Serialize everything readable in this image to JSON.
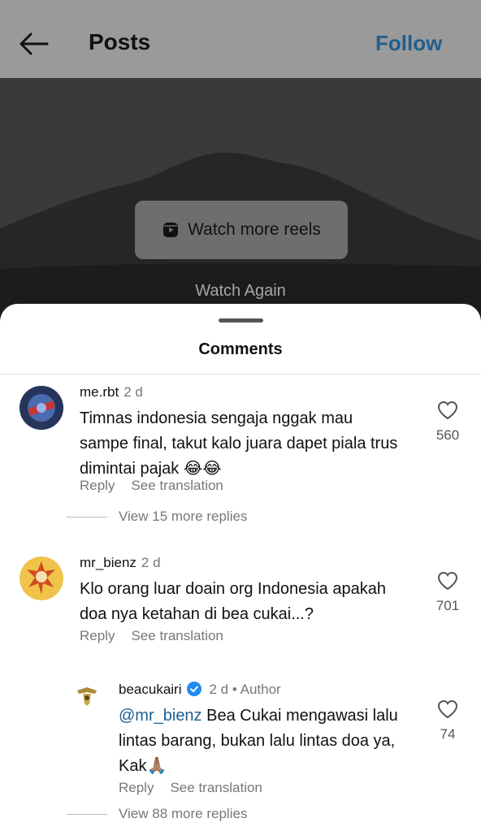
{
  "header": {
    "title": "Posts",
    "follow_label": "Follow"
  },
  "video": {
    "reels_label": "Watch more reels",
    "watch_again": "Watch Again"
  },
  "sheet": {
    "title": "Comments"
  },
  "comments": [
    {
      "username": "me.rbt",
      "time": "2 d",
      "text": "Timnas indonesia sengaja nggak mau sampe final, takut kalo juara dapet piala trus dimintai pajak 😂😂",
      "likes": "560",
      "reply_label": "Reply",
      "translate_label": "See translation",
      "more_replies": "View 15 more replies"
    },
    {
      "username": "mr_bienz",
      "time": "2 d",
      "text": "Klo orang luar doain org Indonesia apakah doa nya ketahan di bea cukai...?",
      "likes": "701",
      "reply_label": "Reply",
      "translate_label": "See translation",
      "reply": {
        "username": "beacukairi",
        "time": "2 d",
        "author_badge": "• Author",
        "mention": "@mr_bienz",
        "text": " Bea Cukai mengawasi lalu lintas barang, bukan lalu lintas doa ya, Kak🙏🏽",
        "likes": "74",
        "reply_label": "Reply",
        "translate_label": "See translation"
      },
      "more_replies": "View 88 more replies"
    }
  ],
  "colors": {
    "header_bg": "#9a9a9a",
    "video_bg": "#3c3c3c",
    "link_blue": "#1f5f8f",
    "verified_blue": "#1d8cf0"
  }
}
